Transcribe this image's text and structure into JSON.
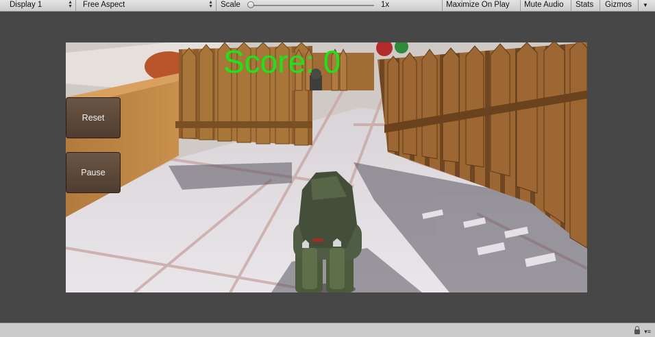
{
  "toolbar": {
    "display": "Display 1",
    "aspect": "Free Aspect",
    "scale_label": "Scale",
    "scale_value": "1x",
    "maximize": "Maximize On Play",
    "mute": "Mute Audio",
    "stats": "Stats",
    "gizmos": "Gizmos",
    "dropdown_arrow": "▴▾",
    "menu_arrow": "▼"
  },
  "game": {
    "score_text": "Score: 0",
    "score_color": "#19e619",
    "reset_label": "Reset",
    "pause_label": "Pause",
    "player_icon": "soldier-character",
    "fence_color": "#9c6a34",
    "floor_color": "#e4e2e6"
  },
  "bottombar": {
    "lock_icon": "lock-icon",
    "menu_icon": "menu-icon"
  }
}
